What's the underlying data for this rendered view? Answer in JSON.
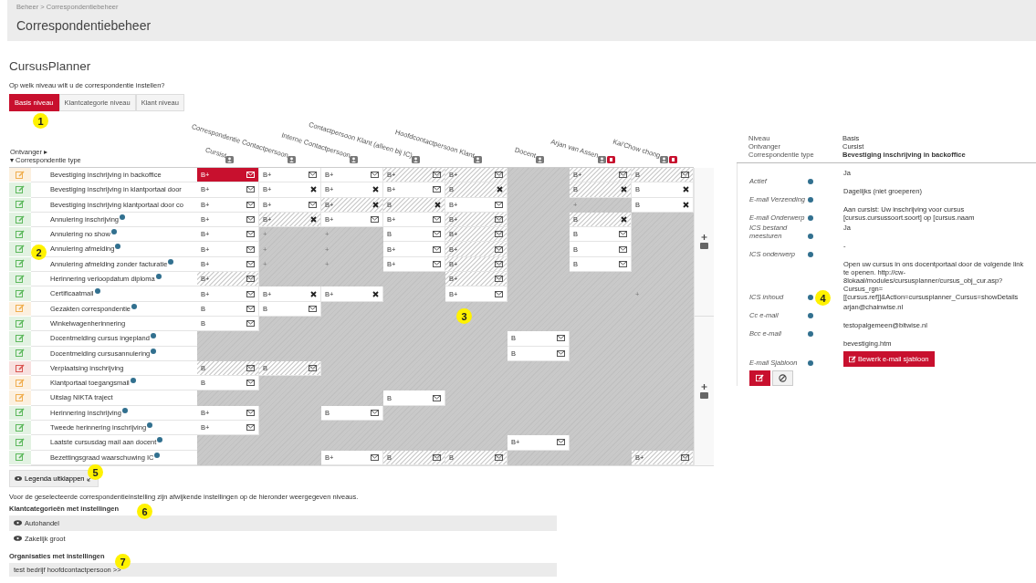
{
  "breadcrumb": "Beheer > Correspondentiebeheer",
  "page_title": "Correspondentiebeheer",
  "section_title": "CursusPlanner",
  "question": "Op welk niveau wilt u de correspondentie instellen?",
  "level_tabs": [
    {
      "label": "Basis niveau",
      "selected": true
    },
    {
      "label": "Klantcategorie niveau",
      "selected": false
    },
    {
      "label": "Klant niveau",
      "selected": false
    }
  ],
  "table": {
    "corner": [
      "Ontvanger ▸",
      "▾ Correspondentie type"
    ],
    "columns": [
      {
        "label": "Cursist",
        "flagged": false
      },
      {
        "label": "Correspondentie Contactpersoon",
        "flagged": false
      },
      {
        "label": "Interne Contactpersoon",
        "flagged": false
      },
      {
        "label": "Contactpersoon Klant (alleen bij IC)",
        "flagged": false
      },
      {
        "label": "Hoofdcontactpersoon Klant",
        "flagged": false
      },
      {
        "label": "Docent",
        "flagged": false
      },
      {
        "label": "Arjan van Assen",
        "flagged": true
      },
      {
        "label": "Kai'Chow chong",
        "flagged": true
      }
    ],
    "rows": [
      {
        "label": "Bevestiging inschrijving in backoffice",
        "info": false,
        "color": "#f0ad4e",
        "cells": [
          {
            "kind": "mail",
            "text": "B+",
            "hatched": false,
            "selected": true
          },
          {
            "kind": "mail",
            "text": "B+",
            "hatched": false,
            "selected": false
          },
          {
            "kind": "mail",
            "text": "B+",
            "hatched": false,
            "selected": false
          },
          {
            "kind": "mail",
            "text": "B+",
            "hatched": true,
            "selected": false
          },
          {
            "kind": "mail",
            "text": "B+",
            "hatched": true,
            "selected": false
          },
          {
            "kind": "empty"
          },
          {
            "kind": "mail",
            "text": "B+",
            "hatched": true,
            "selected": false
          },
          {
            "kind": "mail",
            "text": "B",
            "hatched": true,
            "selected": false
          }
        ]
      },
      {
        "label": "Bevestiging inschrijving in klantportaal door",
        "info": false,
        "color": "#5cb85c",
        "cells": [
          {
            "kind": "mail",
            "text": "B+",
            "hatched": false,
            "selected": false
          },
          {
            "kind": "cross",
            "text": "B+",
            "hatched": false,
            "selected": false
          },
          {
            "kind": "cross",
            "text": "B+",
            "hatched": false,
            "selected": false
          },
          {
            "kind": "mail",
            "text": "B+",
            "hatched": false,
            "selected": false
          },
          {
            "kind": "cross",
            "text": "B",
            "hatched": true,
            "selected": false
          },
          {
            "kind": "empty"
          },
          {
            "kind": "cross",
            "text": "B",
            "hatched": true,
            "selected": false
          },
          {
            "kind": "cross",
            "text": "B",
            "hatched": false,
            "selected": false
          }
        ]
      },
      {
        "label": "Bevestiging inschrijving klantportaal door co",
        "info": false,
        "color": "#5cb85c",
        "cells": [
          {
            "kind": "mail",
            "text": "B+",
            "hatched": false,
            "selected": false
          },
          {
            "kind": "mail",
            "text": "B+",
            "hatched": false,
            "selected": false
          },
          {
            "kind": "cross",
            "text": "B+",
            "hatched": true,
            "selected": false
          },
          {
            "kind": "cross",
            "text": "B",
            "hatched": true,
            "selected": false
          },
          {
            "kind": "mail",
            "text": "B+",
            "hatched": false,
            "selected": false
          },
          {
            "kind": "empty"
          },
          {
            "kind": "plus",
            "text": "+"
          },
          {
            "kind": "cross",
            "text": "B",
            "hatched": false,
            "selected": false
          }
        ]
      },
      {
        "label": "Annulering inschrijving",
        "info": true,
        "color": "#5cb85c",
        "cells": [
          {
            "kind": "mail",
            "text": "B+",
            "hatched": false,
            "selected": false
          },
          {
            "kind": "cross",
            "text": "B+",
            "hatched": true,
            "selected": false
          },
          {
            "kind": "mail",
            "text": "B+",
            "hatched": false,
            "selected": false
          },
          {
            "kind": "mail",
            "text": "B+",
            "hatched": false,
            "selected": false
          },
          {
            "kind": "mail",
            "text": "B+",
            "hatched": true,
            "selected": false
          },
          {
            "kind": "empty"
          },
          {
            "kind": "cross",
            "text": "B",
            "hatched": true,
            "selected": false
          },
          {
            "kind": "empty"
          }
        ]
      },
      {
        "label": "Annulering no show",
        "info": true,
        "color": "#5cb85c",
        "cells": [
          {
            "kind": "mail",
            "text": "B+",
            "hatched": false,
            "selected": false
          },
          {
            "kind": "plus",
            "text": "+"
          },
          {
            "kind": "plus",
            "text": "+"
          },
          {
            "kind": "mail",
            "text": "B",
            "hatched": false,
            "selected": false
          },
          {
            "kind": "mail",
            "text": "B+",
            "hatched": true,
            "selected": false
          },
          {
            "kind": "empty"
          },
          {
            "kind": "mail",
            "text": "B",
            "hatched": false,
            "selected": false
          },
          {
            "kind": "empty"
          }
        ]
      },
      {
        "label": "Annulering afmelding",
        "info": true,
        "color": "#5cb85c",
        "cells": [
          {
            "kind": "mail",
            "text": "B+",
            "hatched": false,
            "selected": false
          },
          {
            "kind": "plus",
            "text": "+"
          },
          {
            "kind": "plus",
            "text": "+"
          },
          {
            "kind": "mail",
            "text": "B+",
            "hatched": false,
            "selected": false
          },
          {
            "kind": "mail",
            "text": "B+",
            "hatched": true,
            "selected": false
          },
          {
            "kind": "empty"
          },
          {
            "kind": "mail",
            "text": "B",
            "hatched": false,
            "selected": false
          },
          {
            "kind": "empty"
          }
        ]
      },
      {
        "label": "Annulering afmelding zonder facturatie",
        "info": true,
        "color": "#5cb85c",
        "cells": [
          {
            "kind": "mail",
            "text": "B+",
            "hatched": false,
            "selected": false
          },
          {
            "kind": "plus",
            "text": "+"
          },
          {
            "kind": "plus",
            "text": "+"
          },
          {
            "kind": "mail",
            "text": "B+",
            "hatched": false,
            "selected": false
          },
          {
            "kind": "mail",
            "text": "B+",
            "hatched": true,
            "selected": false
          },
          {
            "kind": "empty"
          },
          {
            "kind": "mail",
            "text": "B",
            "hatched": false,
            "selected": false
          },
          {
            "kind": "empty"
          }
        ]
      },
      {
        "label": "Herinnering verloopdatum diploma",
        "info": true,
        "color": "#5cb85c",
        "cells": [
          {
            "kind": "mail",
            "text": "B+",
            "hatched": true,
            "selected": false
          },
          {
            "kind": "empty"
          },
          {
            "kind": "empty"
          },
          {
            "kind": "empty"
          },
          {
            "kind": "mail",
            "text": "B+",
            "hatched": true,
            "selected": false
          },
          {
            "kind": "empty"
          },
          {
            "kind": "empty"
          },
          {
            "kind": "empty"
          }
        ]
      },
      {
        "label": "Certificaatmail",
        "info": true,
        "color": "#5cb85c",
        "cells": [
          {
            "kind": "mail",
            "text": "B+",
            "hatched": false,
            "selected": false
          },
          {
            "kind": "cross",
            "text": "B+",
            "hatched": false,
            "selected": false
          },
          {
            "kind": "cross",
            "text": "B+",
            "hatched": false,
            "selected": false
          },
          {
            "kind": "empty"
          },
          {
            "kind": "mail",
            "text": "B+",
            "hatched": false,
            "selected": false
          },
          {
            "kind": "empty"
          },
          {
            "kind": "empty"
          },
          {
            "kind": "plus",
            "text": "+"
          }
        ]
      },
      {
        "label": "Gezakten correspondentie",
        "info": true,
        "color": "#f0ad4e",
        "cells": [
          {
            "kind": "mail",
            "text": "B",
            "hatched": false,
            "selected": false
          },
          {
            "kind": "mail",
            "text": "B",
            "hatched": false,
            "selected": false
          },
          {
            "kind": "empty"
          },
          {
            "kind": "empty"
          },
          {
            "kind": "empty"
          },
          {
            "kind": "empty"
          },
          {
            "kind": "empty"
          },
          {
            "kind": "empty"
          }
        ]
      },
      {
        "label": "Winkelwagenherinnering",
        "info": false,
        "color": "#5cb85c",
        "cells": [
          {
            "kind": "mail",
            "text": "B",
            "hatched": false,
            "selected": false
          },
          {
            "kind": "empty"
          },
          {
            "kind": "empty"
          },
          {
            "kind": "empty"
          },
          {
            "kind": "empty"
          },
          {
            "kind": "empty"
          },
          {
            "kind": "empty"
          },
          {
            "kind": "empty"
          }
        ]
      },
      {
        "label": "Docentmelding cursus ingepland",
        "info": true,
        "color": "#5cb85c",
        "cells": [
          {
            "kind": "empty"
          },
          {
            "kind": "empty"
          },
          {
            "kind": "empty"
          },
          {
            "kind": "empty"
          },
          {
            "kind": "empty"
          },
          {
            "kind": "mail",
            "text": "B",
            "hatched": false,
            "selected": false
          },
          {
            "kind": "empty"
          },
          {
            "kind": "empty"
          }
        ]
      },
      {
        "label": "Docentmelding cursusannulering",
        "info": true,
        "color": "#5cb85c",
        "cells": [
          {
            "kind": "empty"
          },
          {
            "kind": "empty"
          },
          {
            "kind": "empty"
          },
          {
            "kind": "empty"
          },
          {
            "kind": "empty"
          },
          {
            "kind": "mail",
            "text": "B",
            "hatched": false,
            "selected": false
          },
          {
            "kind": "empty"
          },
          {
            "kind": "empty"
          }
        ]
      },
      {
        "label": "Verplaatsing inschrijving",
        "info": false,
        "color": "#d9534f",
        "cells": [
          {
            "kind": "mail",
            "text": "B",
            "hatched": true,
            "selected": false
          },
          {
            "kind": "mail",
            "text": "B",
            "hatched": true,
            "selected": false
          },
          {
            "kind": "empty"
          },
          {
            "kind": "empty"
          },
          {
            "kind": "empty"
          },
          {
            "kind": "empty"
          },
          {
            "kind": "empty"
          },
          {
            "kind": "empty"
          }
        ]
      },
      {
        "label": "Klantportaal toegangsmail",
        "info": true,
        "color": "#f0ad4e",
        "cells": [
          {
            "kind": "mail",
            "text": "B",
            "hatched": false,
            "selected": false
          },
          {
            "kind": "empty"
          },
          {
            "kind": "empty"
          },
          {
            "kind": "empty"
          },
          {
            "kind": "empty"
          },
          {
            "kind": "empty"
          },
          {
            "kind": "empty"
          },
          {
            "kind": "empty"
          }
        ]
      },
      {
        "label": "Uitslag NIKTA traject",
        "info": false,
        "color": "#f0ad4e",
        "cells": [
          {
            "kind": "empty"
          },
          {
            "kind": "empty"
          },
          {
            "kind": "empty"
          },
          {
            "kind": "mail",
            "text": "B",
            "hatched": false,
            "selected": false
          },
          {
            "kind": "empty"
          },
          {
            "kind": "empty"
          },
          {
            "kind": "empty"
          },
          {
            "kind": "empty"
          }
        ]
      },
      {
        "label": "Herinnering inschrijving",
        "info": true,
        "color": "#5cb85c",
        "cells": [
          {
            "kind": "mail",
            "text": "B+",
            "hatched": false,
            "selected": false
          },
          {
            "kind": "empty"
          },
          {
            "kind": "mail",
            "text": "B",
            "hatched": false,
            "selected": false
          },
          {
            "kind": "empty"
          },
          {
            "kind": "empty"
          },
          {
            "kind": "empty"
          },
          {
            "kind": "empty"
          },
          {
            "kind": "empty"
          }
        ]
      },
      {
        "label": "Tweede herinnering inschrijving",
        "info": true,
        "color": "#5cb85c",
        "cells": [
          {
            "kind": "mail",
            "text": "B+",
            "hatched": false,
            "selected": false
          },
          {
            "kind": "empty"
          },
          {
            "kind": "empty"
          },
          {
            "kind": "empty"
          },
          {
            "kind": "empty"
          },
          {
            "kind": "empty"
          },
          {
            "kind": "empty"
          },
          {
            "kind": "empty"
          }
        ]
      },
      {
        "label": "Laatste cursusdag mail aan docent",
        "info": true,
        "color": "#5cb85c",
        "cells": [
          {
            "kind": "empty"
          },
          {
            "kind": "empty"
          },
          {
            "kind": "empty"
          },
          {
            "kind": "empty"
          },
          {
            "kind": "empty"
          },
          {
            "kind": "mail",
            "text": "B+",
            "hatched": false,
            "selected": false
          },
          {
            "kind": "empty"
          },
          {
            "kind": "empty"
          }
        ]
      },
      {
        "label": "Bezettingsgraad waarschuwing IC",
        "info": true,
        "color": "#5cb85c",
        "cells": [
          {
            "kind": "empty"
          },
          {
            "kind": "empty"
          },
          {
            "kind": "mail",
            "text": "B+",
            "hatched": false,
            "selected": false
          },
          {
            "kind": "mail",
            "text": "B",
            "hatched": true,
            "selected": false
          },
          {
            "kind": "mail",
            "text": "B",
            "hatched": true,
            "selected": false
          },
          {
            "kind": "empty"
          },
          {
            "kind": "empty"
          },
          {
            "kind": "mail",
            "text": "B+",
            "hatched": true,
            "selected": false
          }
        ]
      }
    ]
  },
  "detail": {
    "summary": [
      {
        "label": "Niveau",
        "value": "Basis"
      },
      {
        "label": "Ontvanger",
        "value": "Cursist"
      },
      {
        "label": "Correspondentie type",
        "value": "Bevestiging inschrijving in backoffice"
      }
    ],
    "fields": [
      {
        "label": "Actief",
        "value": "Ja"
      },
      {
        "label": "E-mail Verzending",
        "value": "Dagelijks (niet groeperen)"
      },
      {
        "label": "E-mail Onderwerp",
        "value": "Aan cursist: Uw inschrijving voor cursus [cursus.cursussoort.soort] op [cursus.naam"
      },
      {
        "label": "ICS bestand meesturen",
        "value": "Ja"
      },
      {
        "label": "ICS onderwerp",
        "value": "-"
      },
      {
        "label": "ICS inhoud",
        "value": "Open uw cursus in ons docentportaal door de volgende link te openen. http://cw-8lokaal/modules/cursusplanner/cursus_obj_cur.asp?Cursus_rgn=[[cursus.ref]]&Action=cursusplanner_Cursus=showDetails"
      },
      {
        "label": "Cc e-mail",
        "value": "arjan@chainwise.nl"
      },
      {
        "label": "Bcc e-mail",
        "value": "testopalgemeen@bitwise.nl"
      },
      {
        "label": "E-mail Sjabloon",
        "value": "bevestiging.htm",
        "button": "Bewerk e-mail sjabloon"
      }
    ]
  },
  "legend_button": "Legenda uitklappen",
  "notice": "Voor de geselecteerde correspondentieinstelling zijn afwijkende instellingen op de hieronder weergegeven niveaus.",
  "categories": {
    "title": "Klantcategorieën met instellingen",
    "items": [
      "Autohandel",
      "Zakelijk groot"
    ]
  },
  "organisations": {
    "title": "Organisaties met instellingen",
    "items": [
      "test bedrijf hoofdcontactpersoon >>"
    ]
  },
  "callouts": [
    "1",
    "2",
    "3",
    "4",
    "5",
    "6",
    "7"
  ]
}
